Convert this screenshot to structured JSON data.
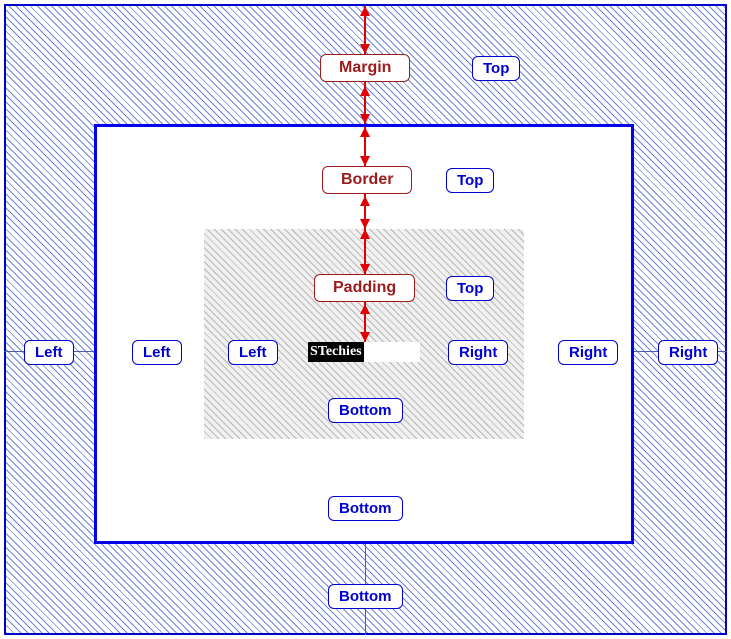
{
  "titles": {
    "margin": "Margin",
    "border": "Border",
    "padding": "Padding"
  },
  "labels": {
    "top": "Top",
    "bottom": "Bottom",
    "left": "Left",
    "right": "Right"
  },
  "content": {
    "text": "STechies"
  },
  "colors": {
    "frame": "#0000cc",
    "title_border": "#9b1c1c",
    "label_border": "#0000d0",
    "arrow": "#e00000"
  }
}
